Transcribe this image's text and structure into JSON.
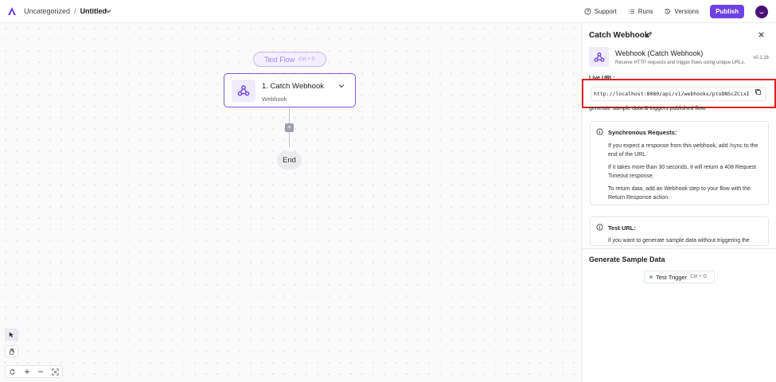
{
  "header": {
    "breadcrumb_folder": "Uncategorized",
    "breadcrumb_separator": "/",
    "breadcrumb_flow": "Untitled",
    "support_label": "Support",
    "runs_label": "Runs",
    "versions_label": "Versions",
    "publish_label": "Publish"
  },
  "canvas": {
    "test_flow_label": "Test Flow",
    "test_flow_shortcut": "Ctrl + D",
    "step": {
      "title": "1. Catch Webhook",
      "subtitle": "Webhook"
    },
    "add_step_label": "+",
    "end_label": "End"
  },
  "panel": {
    "title": "Catch Webhook",
    "trigger_name": "Webhook (Catch Webhook)",
    "trigger_description": "Receive HTTP requests and trigger flows using unique URLs.",
    "version": "v0.1.16",
    "live_url_label": "Live URL:",
    "live_url_value": "http://localhost:8080/api/v1/webhooks/ptoDNScZCixI",
    "generate_note": "generate sample data & triggers published flow.",
    "sync": {
      "heading": "Synchronous Requests:",
      "p1": "If you expect a response from this webhook, add /sync to the end of the URL.",
      "p2": "If it takes more than 30 seconds, it will return a 408 Request Timeout response.",
      "p3": "To return data, add an Webhook step to your flow with the Return Response action."
    },
    "test_url": {
      "heading": "Test URL:",
      "p1": "if you want to generate sample data without triggering the"
    },
    "sample_title": "Generate Sample Data",
    "test_trigger_label": "Test Trigger",
    "test_trigger_shortcut": "Ctrl + G"
  },
  "colors": {
    "accent": "#6e41e2",
    "highlight_border": "#e02020"
  }
}
